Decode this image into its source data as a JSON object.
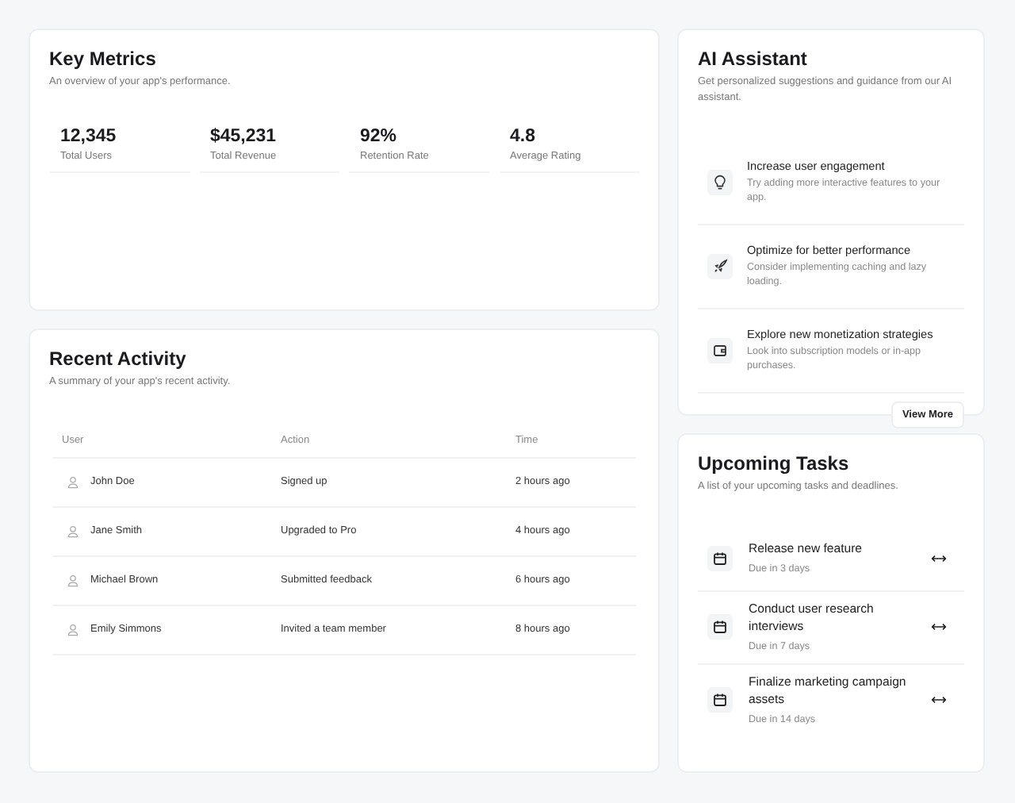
{
  "key_metrics": {
    "title": "Key Metrics",
    "subtitle": "An overview of your app's performance.",
    "metrics": [
      {
        "value": "12,345",
        "label": "Total Users"
      },
      {
        "value": "$45,231",
        "label": "Total Revenue"
      },
      {
        "value": "92%",
        "label": "Retention Rate"
      },
      {
        "value": "4.8",
        "label": "Average Rating"
      }
    ]
  },
  "recent_activity": {
    "title": "Recent Activity",
    "subtitle": "A summary of your app's recent activity.",
    "columns": [
      "User",
      "Action",
      "Time"
    ],
    "rows": [
      {
        "user": "John Doe",
        "action": "Signed up",
        "time": "2 hours ago"
      },
      {
        "user": "Jane Smith",
        "action": "Upgraded to Pro",
        "time": "4 hours ago"
      },
      {
        "user": "Michael Brown",
        "action": "Submitted feedback",
        "time": "6 hours ago"
      },
      {
        "user": "Emily Simmons",
        "action": "Invited a team member",
        "time": "8 hours ago"
      }
    ]
  },
  "ai_assistant": {
    "title": "AI Assistant",
    "subtitle": "Get personalized suggestions and guidance from our AI assistant.",
    "suggestions": [
      {
        "title": "Increase user engagement",
        "text": "Try adding more interactive features to your app."
      },
      {
        "title": "Optimize for better performance",
        "text": "Consider implementing caching and lazy loading."
      },
      {
        "title": "Explore new monetization strategies",
        "text": "Look into subscription models or in-app purchases."
      }
    ],
    "button": "View More"
  },
  "upcoming_tasks": {
    "title": "Upcoming Tasks",
    "subtitle": "A list of your upcoming tasks and deadlines.",
    "tasks": [
      {
        "title": "Release new feature",
        "due": "Due in 3 days"
      },
      {
        "title": "Conduct user research interviews",
        "due": "Due in 7 days"
      },
      {
        "title": "Finalize marketing campaign assets",
        "due": "Due in 14 days"
      }
    ]
  }
}
